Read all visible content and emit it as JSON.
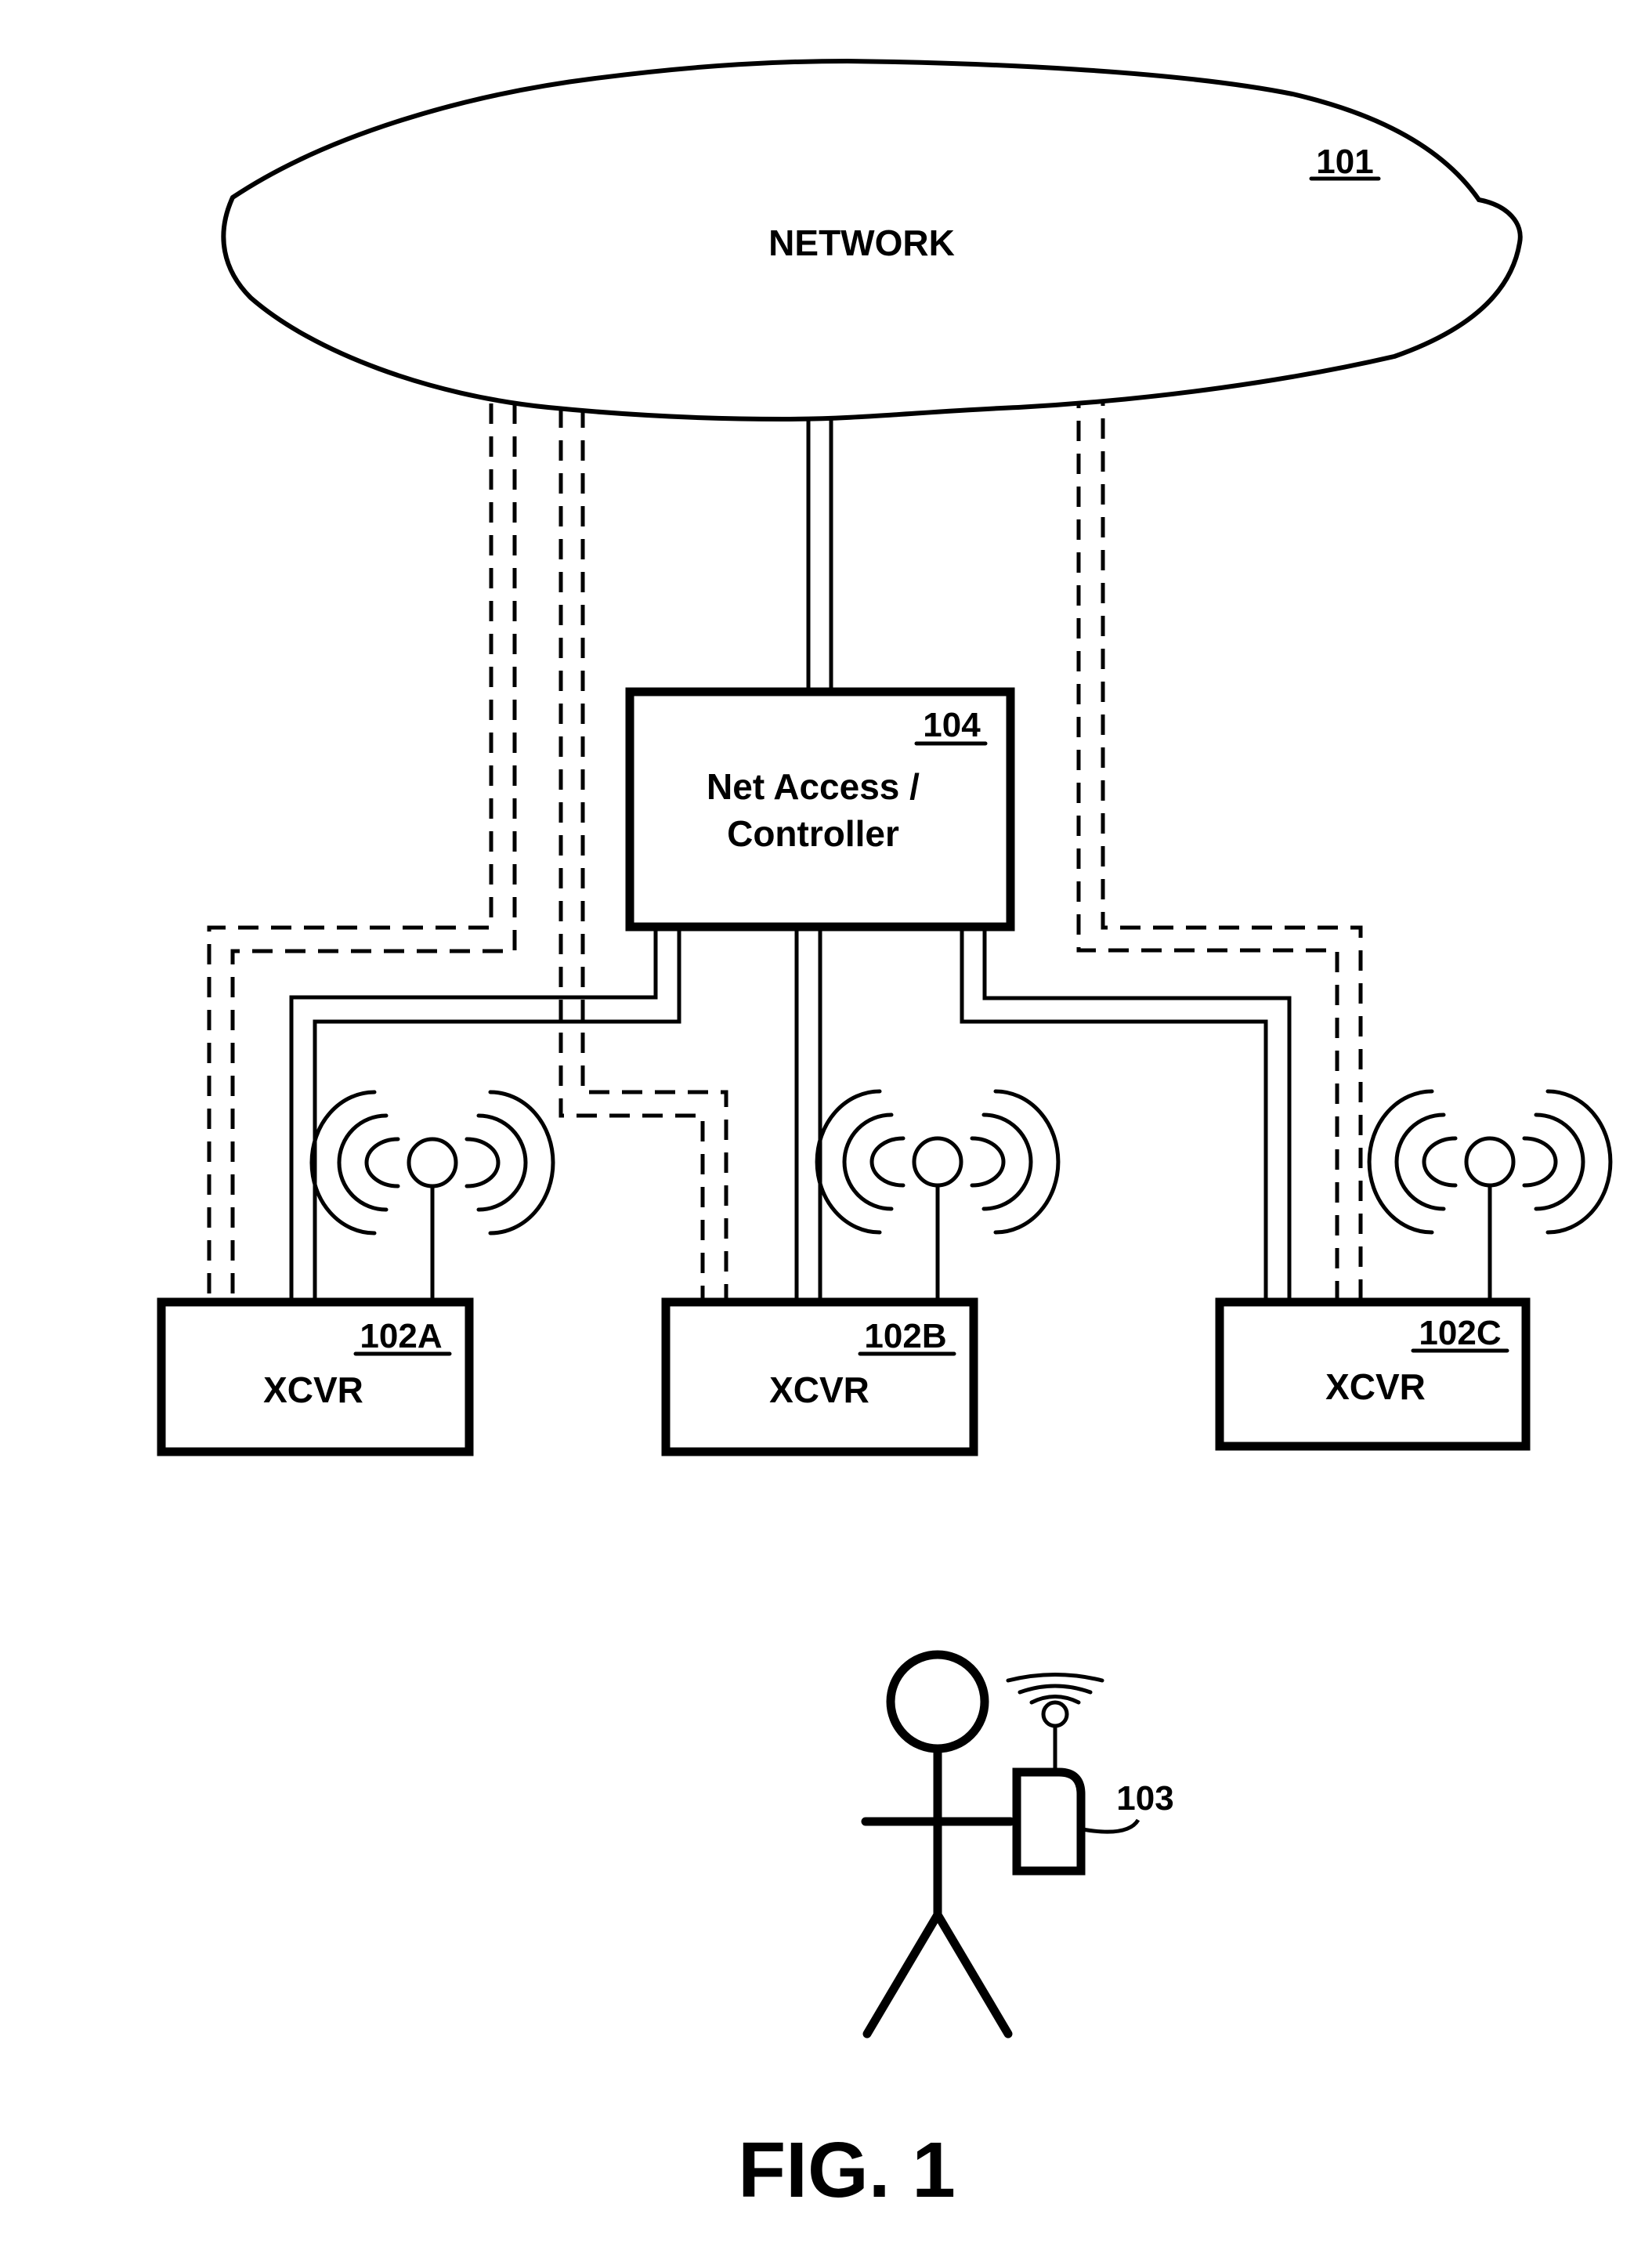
{
  "figure": {
    "caption": "FIG. 1",
    "foreground_color": "#000000",
    "background_color": "#ffffff"
  },
  "network": {
    "label": "NETWORK",
    "ref": "101"
  },
  "controller": {
    "line1": "Net Access /",
    "line2": "Controller",
    "ref": "104"
  },
  "transceivers": [
    {
      "label": "XCVR",
      "ref": "102A"
    },
    {
      "label": "XCVR",
      "ref": "102B"
    },
    {
      "label": "XCVR",
      "ref": "102C"
    }
  ],
  "user_device": {
    "ref": "103"
  },
  "links": {
    "solid": [
      "network-to-controller",
      "controller-to-102A",
      "controller-to-102B",
      "controller-to-102C"
    ],
    "dashed": [
      "network-to-102A",
      "network-to-102B",
      "network-to-102C"
    ]
  }
}
